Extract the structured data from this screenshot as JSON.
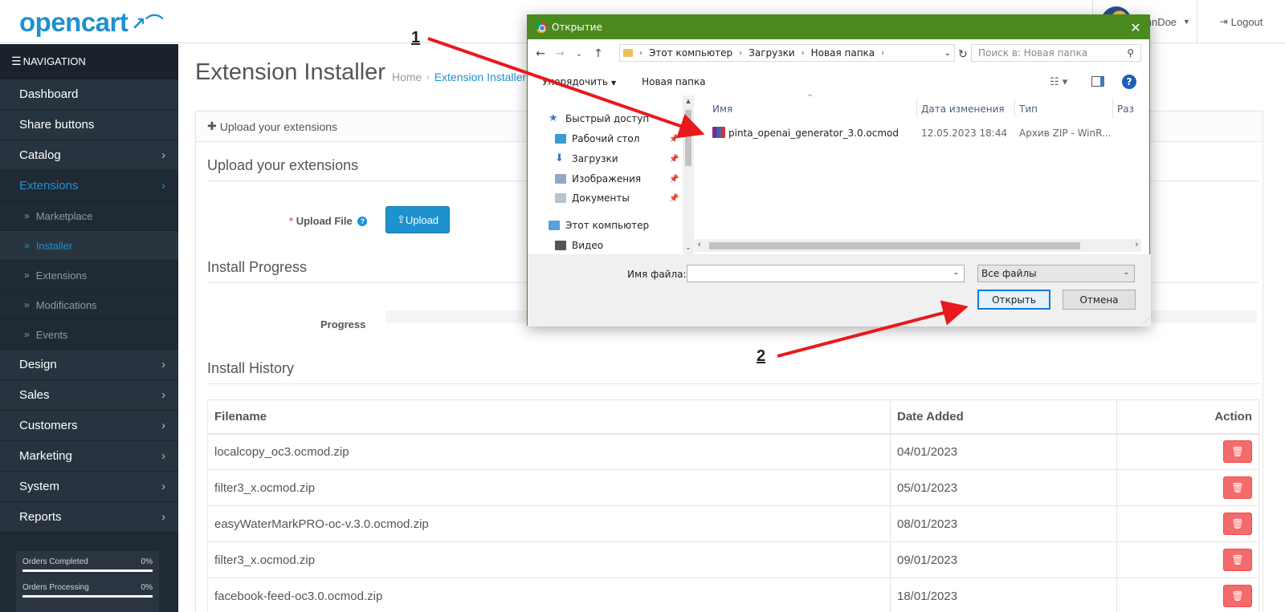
{
  "header": {
    "logo": "opencart",
    "logo_cart": "↗⌒",
    "user_name": "JohnDoe",
    "logout": "Logout"
  },
  "sidebar": {
    "heading": "NAVIGATION",
    "items_top": [
      {
        "label": "Dashboard"
      },
      {
        "label": "Share buttons"
      },
      {
        "label": "Catalog"
      },
      {
        "label": "Extensions"
      }
    ],
    "sub_items": [
      {
        "label": "Marketplace"
      },
      {
        "label": "Installer"
      },
      {
        "label": "Extensions"
      },
      {
        "label": "Modifications"
      },
      {
        "label": "Events"
      }
    ],
    "items_bottom": [
      {
        "label": "Design"
      },
      {
        "label": "Sales"
      },
      {
        "label": "Customers"
      },
      {
        "label": "Marketing"
      },
      {
        "label": "System"
      },
      {
        "label": "Reports"
      }
    ],
    "stats": [
      {
        "label": "Orders Completed",
        "value": "0%",
        "progress": 0
      },
      {
        "label": "Orders Processing",
        "value": "0%",
        "progress": 0
      }
    ]
  },
  "main": {
    "title": "Extension Installer",
    "breadcrumb": [
      "Home",
      "Extension Installer"
    ],
    "panel_heading": "Upload your extensions",
    "upload_legend": "Upload your extensions",
    "upload_label": "Upload File",
    "required_mark": "*",
    "help_icon": "?",
    "upload_button": "Upload",
    "progress_legend": "Install Progress",
    "progress_label": "Progress",
    "progress_value": 0,
    "history_legend": "Install History",
    "history_columns": [
      "Filename",
      "Date Added",
      "Action"
    ],
    "history_rows": [
      {
        "filename": "localcopy_oc3.ocmod.zip",
        "date": "04/01/2023"
      },
      {
        "filename": "filter3_x.ocmod.zip",
        "date": "05/01/2023"
      },
      {
        "filename": "easyWaterMarkPRO-oc-v.3.0.ocmod.zip",
        "date": "08/01/2023"
      },
      {
        "filename": "filter3_x.ocmod.zip",
        "date": "09/01/2023"
      },
      {
        "filename": "facebook-feed-oc3.0.ocmod.zip",
        "date": "18/01/2023"
      }
    ]
  },
  "dialog": {
    "title": "Открытие",
    "address": [
      "Этот компьютер",
      "Загрузки",
      "Новая папка"
    ],
    "search_placeholder": "Поиск в: Новая папка",
    "organize": "Упорядочить",
    "new_folder": "Новая папка",
    "tree": [
      {
        "label": "Быстрый доступ",
        "icon": "star-icon",
        "color": "#3a7ac2"
      },
      {
        "label": "Рабочий стол",
        "icon": "desktop-icon",
        "color": "#3a9ad9"
      },
      {
        "label": "Загрузки",
        "icon": "download-icon",
        "color": "#3a7ac2"
      },
      {
        "label": "Изображения",
        "icon": "pictures-icon",
        "color": "#8fa9c2"
      },
      {
        "label": "Документы",
        "icon": "documents-icon",
        "color": "#b9c3cc"
      },
      {
        "label": "Этот компьютер",
        "icon": "computer-icon",
        "color": "#5aa0d8"
      },
      {
        "label": "Видео",
        "icon": "video-icon",
        "color": "#555555"
      }
    ],
    "columns": [
      "Имя",
      "Дата изменения",
      "Тип",
      "Раз"
    ],
    "file": {
      "name": "pinta_openai_generator_3.0.ocmod",
      "date": "12.05.2023 18:44",
      "type": "Архив ZIP - WinR..."
    },
    "filename_label": "Имя файла:",
    "filename_value": "",
    "filter": "Все файлы",
    "open_button": "Открыть",
    "cancel_button": "Отмена"
  },
  "annotations": {
    "step1": "1",
    "step2": "2",
    "arrow_color": "#e8191c"
  }
}
